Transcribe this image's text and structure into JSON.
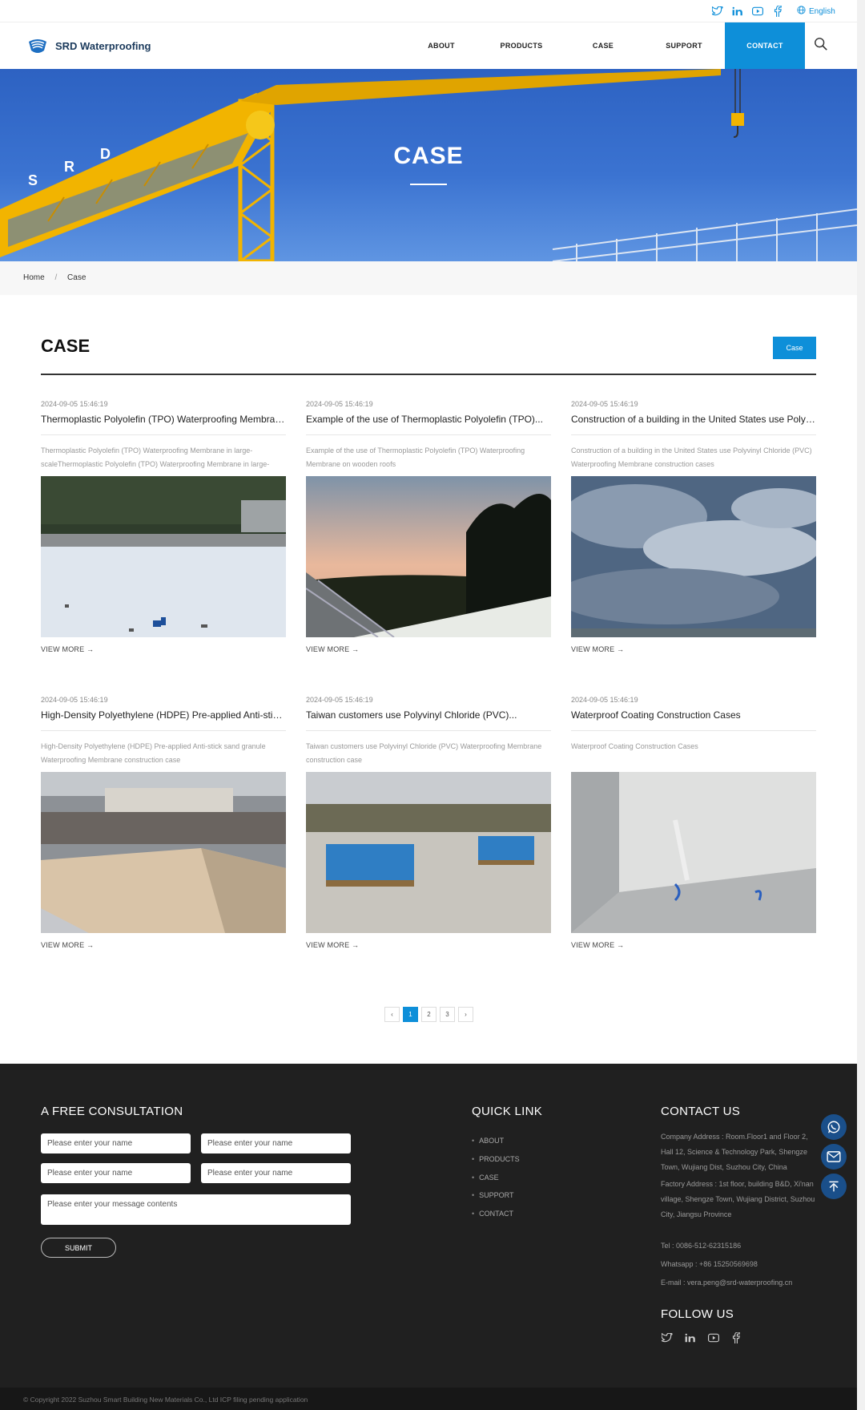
{
  "topbar": {
    "language": "English"
  },
  "header": {
    "brand": "SRD Waterproofing",
    "nav": [
      "ABOUT",
      "PRODUCTS",
      "CASE",
      "SUPPORT",
      "CONTACT"
    ]
  },
  "hero": {
    "title": "CASE"
  },
  "breadcrumb": {
    "home": "Home",
    "sep": "/",
    "current": "Case"
  },
  "section": {
    "title": "CASE",
    "button": "Case"
  },
  "cards": [
    {
      "date": "2024-09-05 15:46:19",
      "title": "Thermoplastic Polyolefin (TPO) Waterproofing Membrane in",
      "desc": "Thermoplastic Polyolefin (TPO) Waterproofing Membrane in large-scaleThermoplastic Polyolefin (TPO) Waterproofing Membrane in large-scale",
      "more": "VIEW MORE  →"
    },
    {
      "date": "2024-09-05 15:46:19",
      "title": "Example of the use of Thermoplastic Polyolefin (TPO)...",
      "desc": "Example of the use of Thermoplastic Polyolefin (TPO) Waterproofing Membrane on wooden roofs",
      "more": "VIEW MORE  →"
    },
    {
      "date": "2024-09-05 15:46:19",
      "title": "Construction of a building in the United States use Polyvin...",
      "desc": "Construction of a building in the United States use Polyvinyl Chloride (PVC) Waterproofing Membrane construction cases",
      "more": "VIEW MORE  →"
    },
    {
      "date": "2024-09-05 15:46:19",
      "title": "High-Density Polyethylene (HDPE) Pre-applied Anti-stick...",
      "desc": "High-Density Polyethylene (HDPE) Pre-applied Anti-stick sand granule Waterproofing Membrane construction case",
      "more": "VIEW MORE  →"
    },
    {
      "date": "2024-09-05 15:46:19",
      "title": "Taiwan customers use Polyvinyl Chloride (PVC)...",
      "desc": "Taiwan customers use Polyvinyl Chloride (PVC) Waterproofing Membrane construction case",
      "more": "VIEW MORE  →"
    },
    {
      "date": "2024-09-05 15:46:19",
      "title": "Waterproof Coating Construction Cases",
      "desc": "Waterproof Coating Construction Cases",
      "more": "VIEW MORE  →"
    }
  ],
  "pager": {
    "prev": "‹",
    "pages": [
      "1",
      "2",
      "3"
    ],
    "next": "›",
    "current": "1"
  },
  "footer": {
    "consult_title": "A FREE CONSULTATION",
    "placeholders": [
      "Please enter your name",
      "Please enter your name",
      "Please enter your name",
      "Please enter your name",
      "Please enter your message contents"
    ],
    "submit": "SUBMIT",
    "quick_title": "QUICK LINK",
    "quick_links": [
      "ABOUT",
      "PRODUCTS",
      "CASE",
      "SUPPORT",
      "CONTACT"
    ],
    "contact_title": "CONTACT US",
    "company_address": "Company Address : Room.Floor1 and Floor 2, Hall 12, Science & Technology Park, Shengze Town, Wujiang Dist, Suzhou City, China",
    "factory_address": "Factory Address : 1st floor, building B&D, Xi'nan village, Shengze Town, Wujiang District, Suzhou City, Jiangsu Province",
    "tel": "Tel : 0086-512-62315186",
    "whatsapp": "Whatsapp : +86 15250569698",
    "email": "E-mail : vera.peng@srd-waterproofing.cn",
    "follow_title": "FOLLOW US",
    "copyright": "© Copyright 2022 Suzhou Smart Building New Materials Co., Ltd ICP filing pending application"
  },
  "icons": [
    "twitter-icon",
    "linkedin-icon",
    "youtube-icon",
    "facebook-icon",
    "globe-icon",
    "search-icon",
    "whatsapp-icon",
    "mail-icon",
    "back-to-top-icon"
  ],
  "colors": {
    "accent": "#0e8fd9",
    "footer": "#202020",
    "float": "#1a4f8a"
  }
}
